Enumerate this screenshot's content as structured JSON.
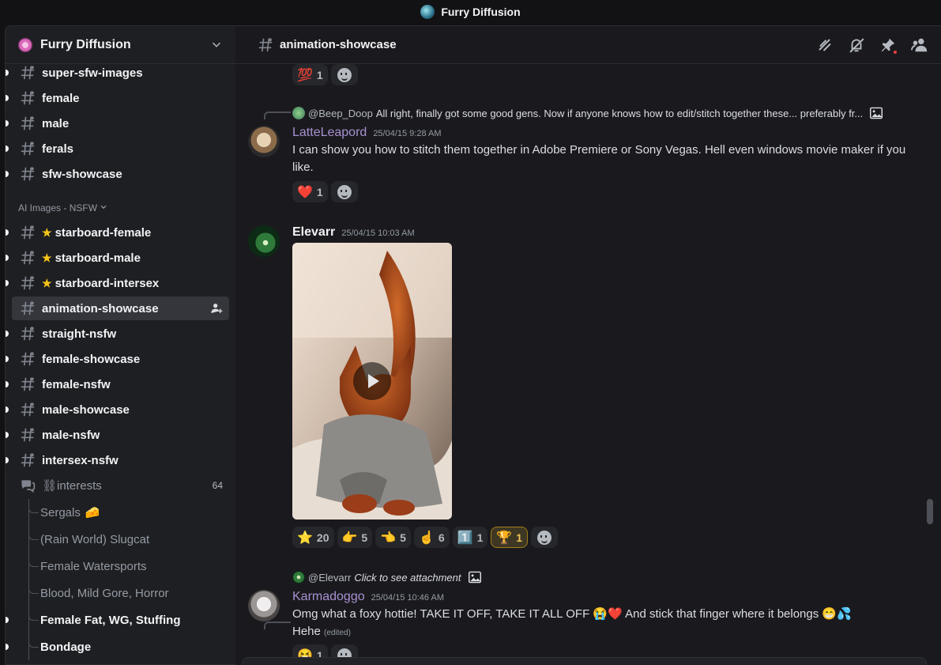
{
  "window": {
    "title": "Furry Diffusion"
  },
  "server": {
    "name": "Furry Diffusion"
  },
  "sidebar": {
    "channels_top": [
      {
        "name": "super-sfw-images",
        "unread": true
      },
      {
        "name": "female",
        "unread": true
      },
      {
        "name": "male",
        "unread": true
      },
      {
        "name": "ferals",
        "unread": true
      },
      {
        "name": "sfw-showcase",
        "unread": true
      }
    ],
    "category_nsfw": "AI Images - NSFW",
    "channels_nsfw": [
      {
        "name": "starboard-female",
        "unread": true,
        "star": true
      },
      {
        "name": "starboard-male",
        "unread": true,
        "star": true
      },
      {
        "name": "starboard-intersex",
        "unread": true,
        "star": true
      },
      {
        "name": "animation-showcase",
        "unread": false,
        "active": true
      },
      {
        "name": "straight-nsfw",
        "unread": true
      },
      {
        "name": "female-showcase",
        "unread": true
      },
      {
        "name": "female-nsfw",
        "unread": true
      },
      {
        "name": "male-showcase",
        "unread": true
      },
      {
        "name": "male-nsfw",
        "unread": true
      },
      {
        "name": "intersex-nsfw",
        "unread": true
      }
    ],
    "star_glyph": "★",
    "forum": {
      "name": "⛓interests",
      "count": "64"
    },
    "threads": [
      {
        "name": "Sergals",
        "emoji": "🧀",
        "unread": false
      },
      {
        "name": "(Rain World) Slugcat",
        "unread": false
      },
      {
        "name": "Female Watersports",
        "unread": false
      },
      {
        "name": "Blood, Mild Gore, Horror",
        "unread": false
      },
      {
        "name": "Female Fat, WG, Stuffing",
        "unread": true
      },
      {
        "name": "Bondage",
        "unread": true
      }
    ]
  },
  "channel": {
    "name": "animation-showcase"
  },
  "header_icons": [
    "threads-icon",
    "mute-icon",
    "pin-icon",
    "members-icon"
  ],
  "messages": {
    "top_reactions": [
      {
        "emoji": "💯",
        "count": "1"
      }
    ],
    "latte": {
      "reply_user": "@Beep_Doop",
      "reply_text": "All right, finally got some good gens. Now if anyone knows how to edit/stitch together these... preferably fr...",
      "author": "LatteLeapord",
      "author_color": "#a891d1",
      "timestamp": "25/04/15 9:28 AM",
      "text": "I can show you how to stitch them together in Adobe Premiere or Sony Vegas. Hell even windows movie maker if you like.",
      "reactions": [
        {
          "emoji": "❤️",
          "count": "1"
        }
      ]
    },
    "elevarr": {
      "author": "Elevarr",
      "author_color": "#f2f3f5",
      "timestamp": "25/04/15 10:03 AM",
      "reactions": [
        {
          "emoji": "⭐",
          "count": "20"
        },
        {
          "emoji": "👉",
          "count": "5"
        },
        {
          "emoji": "👈",
          "count": "5"
        },
        {
          "emoji": "☝️",
          "count": "6"
        },
        {
          "emoji": "1️⃣",
          "count": "1"
        },
        {
          "emoji": "🏆",
          "count": "1",
          "mine": true
        }
      ]
    },
    "karma": {
      "reply_user": "@Elevarr",
      "reply_text": "Click to see attachment",
      "author": "Karmadoggo",
      "author_color": "#a891d1",
      "timestamp": "25/04/15 10:46 AM",
      "text_line1": "Omg what a foxy hottie! TAKE IT OFF, TAKE IT ALL OFF 😭❤️ And stick that finger where it belongs 😁💦",
      "text_line2": "Hehe",
      "edited": "(edited)",
      "reactions": [
        {
          "emoji": "😆",
          "count": "1"
        }
      ]
    }
  }
}
